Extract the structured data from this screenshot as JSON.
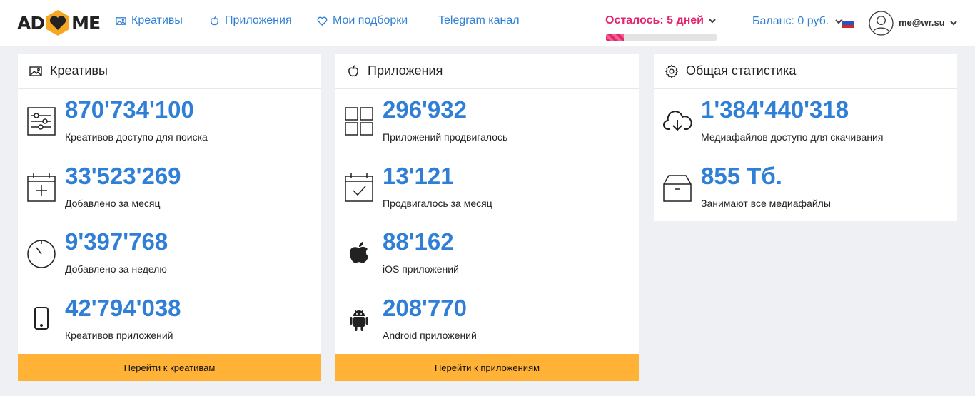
{
  "header": {
    "logo_left": "AD",
    "logo_right": "ME",
    "nav": [
      {
        "label": "Креативы",
        "icon": "image-icon"
      },
      {
        "label": "Приложения",
        "icon": "apple-icon"
      },
      {
        "label": "Мои подборки",
        "icon": "heart-icon"
      },
      {
        "label": "Telegram канал",
        "icon": ""
      }
    ],
    "remaining_label": "Осталось: 5 дней",
    "remaining_progress": 0.16,
    "balance_label": "Баланс: 0 руб.",
    "language": "ru",
    "user_email": "me@wr.su"
  },
  "colors": {
    "accent": "#2f7fd6",
    "remaining": "#e2256c",
    "button": "#ffb236"
  },
  "creatives": {
    "title": "Креативы",
    "stats": [
      {
        "value": "870'734'100",
        "label": "Креативов доступо для поиска",
        "icon": "sliders-icon"
      },
      {
        "value": "33'523'269",
        "label": "Добавлено за месяц",
        "icon": "calendar-plus-icon"
      },
      {
        "value": "9'397'768",
        "label": "Добавлено за неделю",
        "icon": "stopwatch-icon"
      },
      {
        "value": "42'794'038",
        "label": "Креативов приложений",
        "icon": "mobile-icon"
      }
    ],
    "button_label": "Перейти к креативам"
  },
  "apps": {
    "title": "Приложения",
    "stats": [
      {
        "value": "296'932",
        "label": "Приложений продвигалось",
        "icon": "grid-icon"
      },
      {
        "value": "13'121",
        "label": "Продвигалось за месяц",
        "icon": "calendar-check-icon"
      },
      {
        "value": "88'162",
        "label": "iOS приложений",
        "icon": "apple-icon"
      },
      {
        "value": "208'770",
        "label": "Android приложений",
        "icon": "android-icon"
      }
    ],
    "button_label": "Перейти к приложениям"
  },
  "overall": {
    "title": "Общая статистика",
    "stats": [
      {
        "value": "1'384'440'318",
        "label": "Медиафайлов доступо для скачивания",
        "icon": "cloud-download-icon"
      },
      {
        "value": "855 Тб.",
        "label": "Занимают все медиафайлы",
        "icon": "archive-box-icon"
      }
    ]
  }
}
